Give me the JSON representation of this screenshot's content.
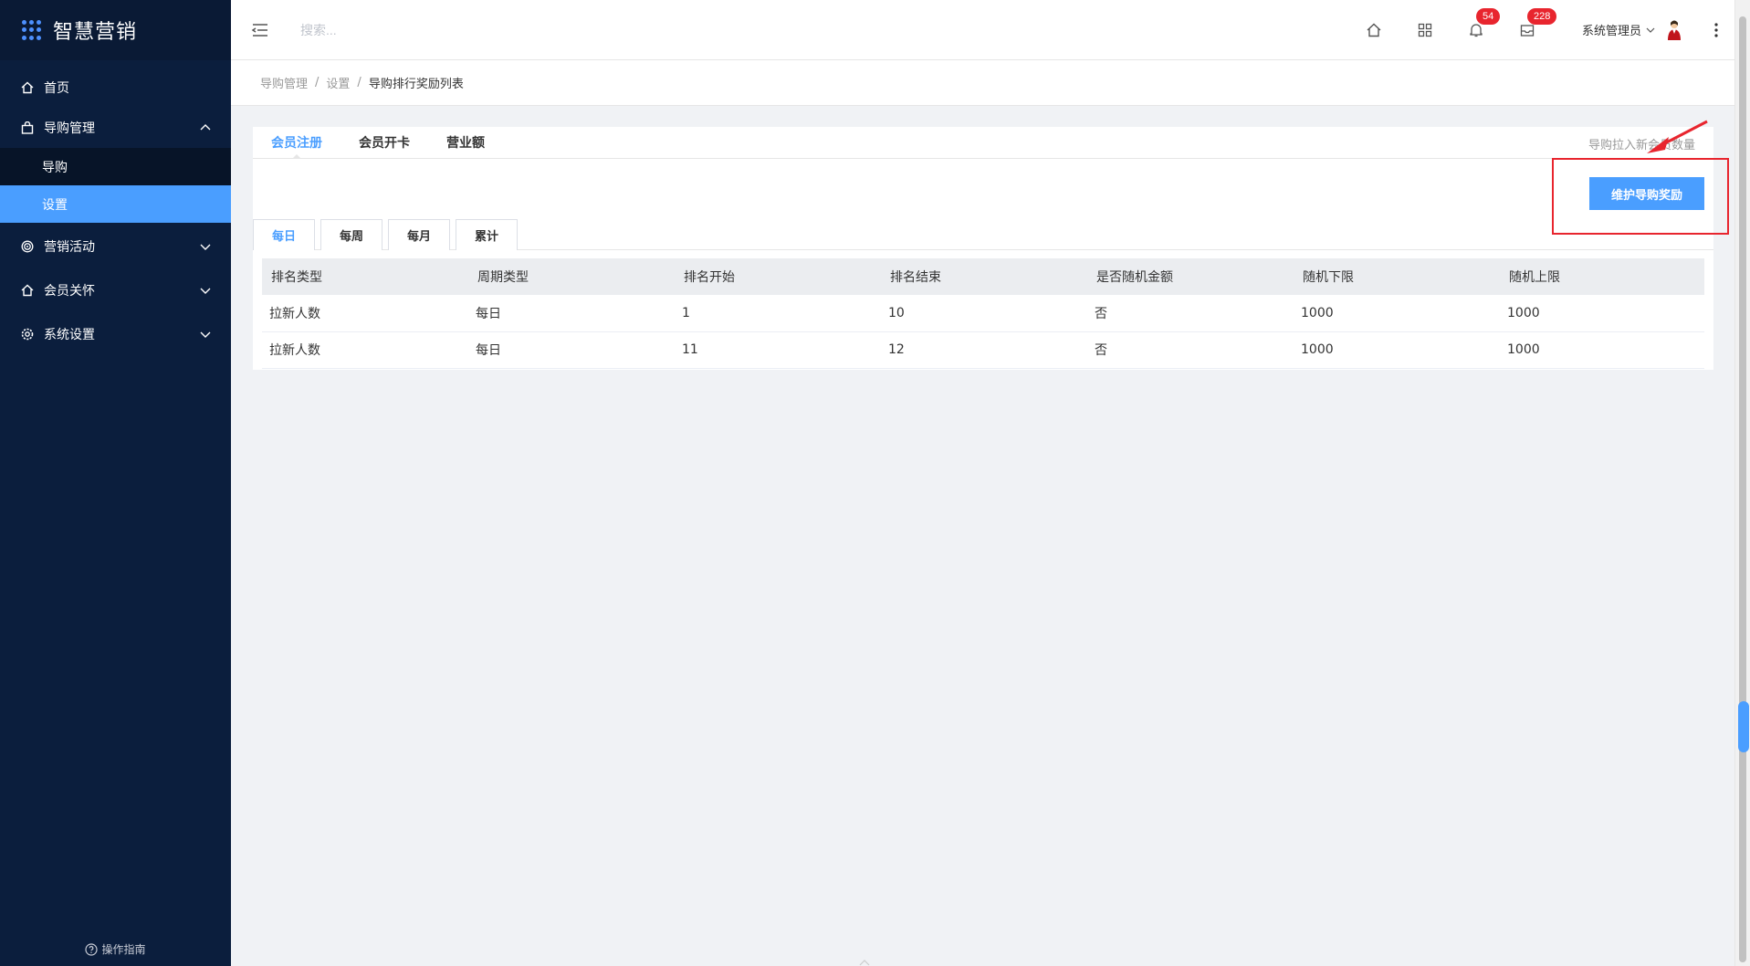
{
  "app": {
    "title": "智慧营销"
  },
  "sidebar": {
    "items": [
      {
        "label": "首页",
        "icon": "home-icon"
      },
      {
        "label": "导购管理",
        "icon": "bag-icon",
        "expanded": true,
        "children": [
          {
            "label": "导购"
          },
          {
            "label": "设置",
            "active": true
          }
        ]
      },
      {
        "label": "营销活动",
        "icon": "target-icon"
      },
      {
        "label": "会员关怀",
        "icon": "home-icon"
      },
      {
        "label": "系统设置",
        "icon": "gear-icon"
      }
    ],
    "guide_label": "操作指南"
  },
  "header": {
    "search_placeholder": "搜索...",
    "notifications_count": "54",
    "messages_count": "228",
    "user_name": "系统管理员"
  },
  "breadcrumb": {
    "items": [
      "导购管理",
      "设置",
      "导购排行奖励列表"
    ]
  },
  "main": {
    "tabs": [
      {
        "label": "会员注册",
        "active": true
      },
      {
        "label": "会员开卡"
      },
      {
        "label": "营业额"
      }
    ],
    "tabs_right_text": "导购拉入新会员数量",
    "primary_button": "维护导购奖励",
    "subtabs": [
      {
        "label": "每日",
        "active": true
      },
      {
        "label": "每周"
      },
      {
        "label": "每月"
      },
      {
        "label": "累计"
      }
    ],
    "table": {
      "columns": [
        "排名类型",
        "周期类型",
        "排名开始",
        "排名结束",
        "是否随机金额",
        "随机下限",
        "随机上限"
      ],
      "rows": [
        [
          "拉新人数",
          "每日",
          "1",
          "10",
          "否",
          "1000",
          "1000"
        ],
        [
          "拉新人数",
          "每日",
          "11",
          "12",
          "否",
          "1000",
          "1000"
        ]
      ]
    }
  },
  "colors": {
    "sidebar_bg": "#0b1e3d",
    "accent": "#4a9eff",
    "badge": "#e8252e",
    "annotation": "#e8252e"
  }
}
